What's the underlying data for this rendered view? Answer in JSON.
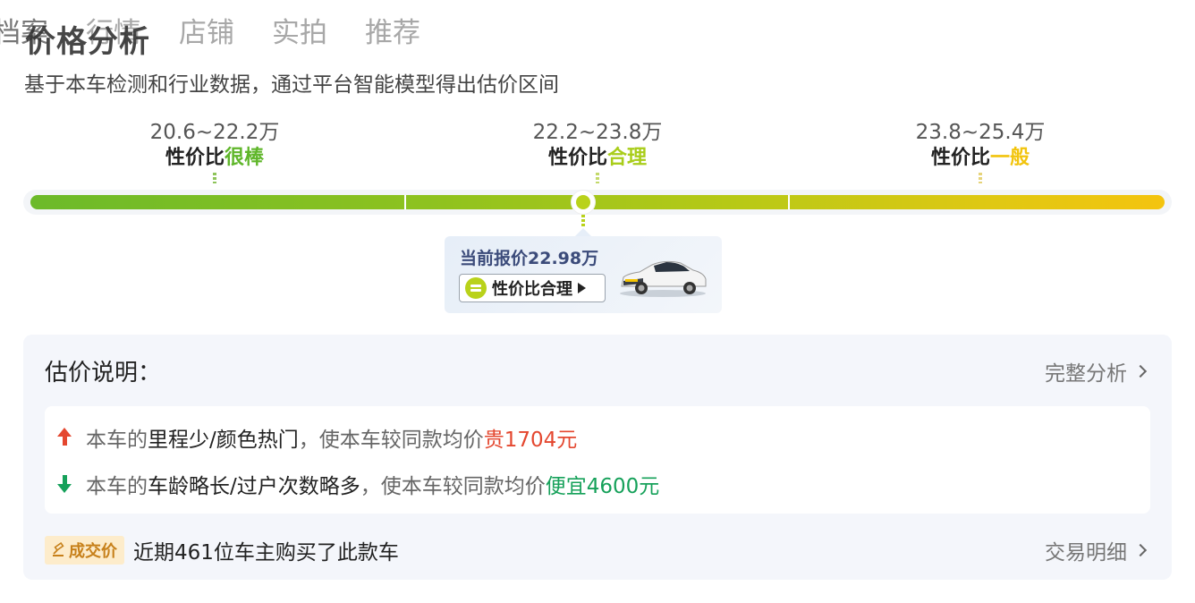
{
  "tabs": [
    "档案",
    "行情",
    "店铺",
    "实拍",
    "推荐"
  ],
  "title": "价格分析",
  "subtitle": "基于本车检测和行业数据，通过平台智能模型得出估价区间",
  "ranges": [
    {
      "price": "20.6~22.2万",
      "prefix": "性价比",
      "level": "很棒",
      "color": "#5fb62a"
    },
    {
      "price": "22.2~23.8万",
      "prefix": "性价比",
      "level": "合理",
      "color": "#a9cd1a"
    },
    {
      "price": "23.8~25.4万",
      "prefix": "性价比",
      "level": "一般",
      "color": "#f2c40d"
    }
  ],
  "current": {
    "label": "当前报价22.98万",
    "rating_label": "性价比合理",
    "position_fraction": 0.49
  },
  "explanation": {
    "heading": "估价说明：",
    "full_analysis_label": "完整分析",
    "items": [
      {
        "prefix": "本车的",
        "factors": "里程少/颜色热门",
        "middle": "，使本车较同款均价",
        "delta": "贵1704元",
        "direction": "up"
      },
      {
        "prefix": "本车的",
        "factors": "车龄略长/过户次数略多",
        "middle": "，使本车较同款均价",
        "delta": "便宜4600元",
        "direction": "down"
      }
    ]
  },
  "deal": {
    "badge": "成交价",
    "text": "近期461位车主购买了此款车",
    "link_label": "交易明细"
  }
}
